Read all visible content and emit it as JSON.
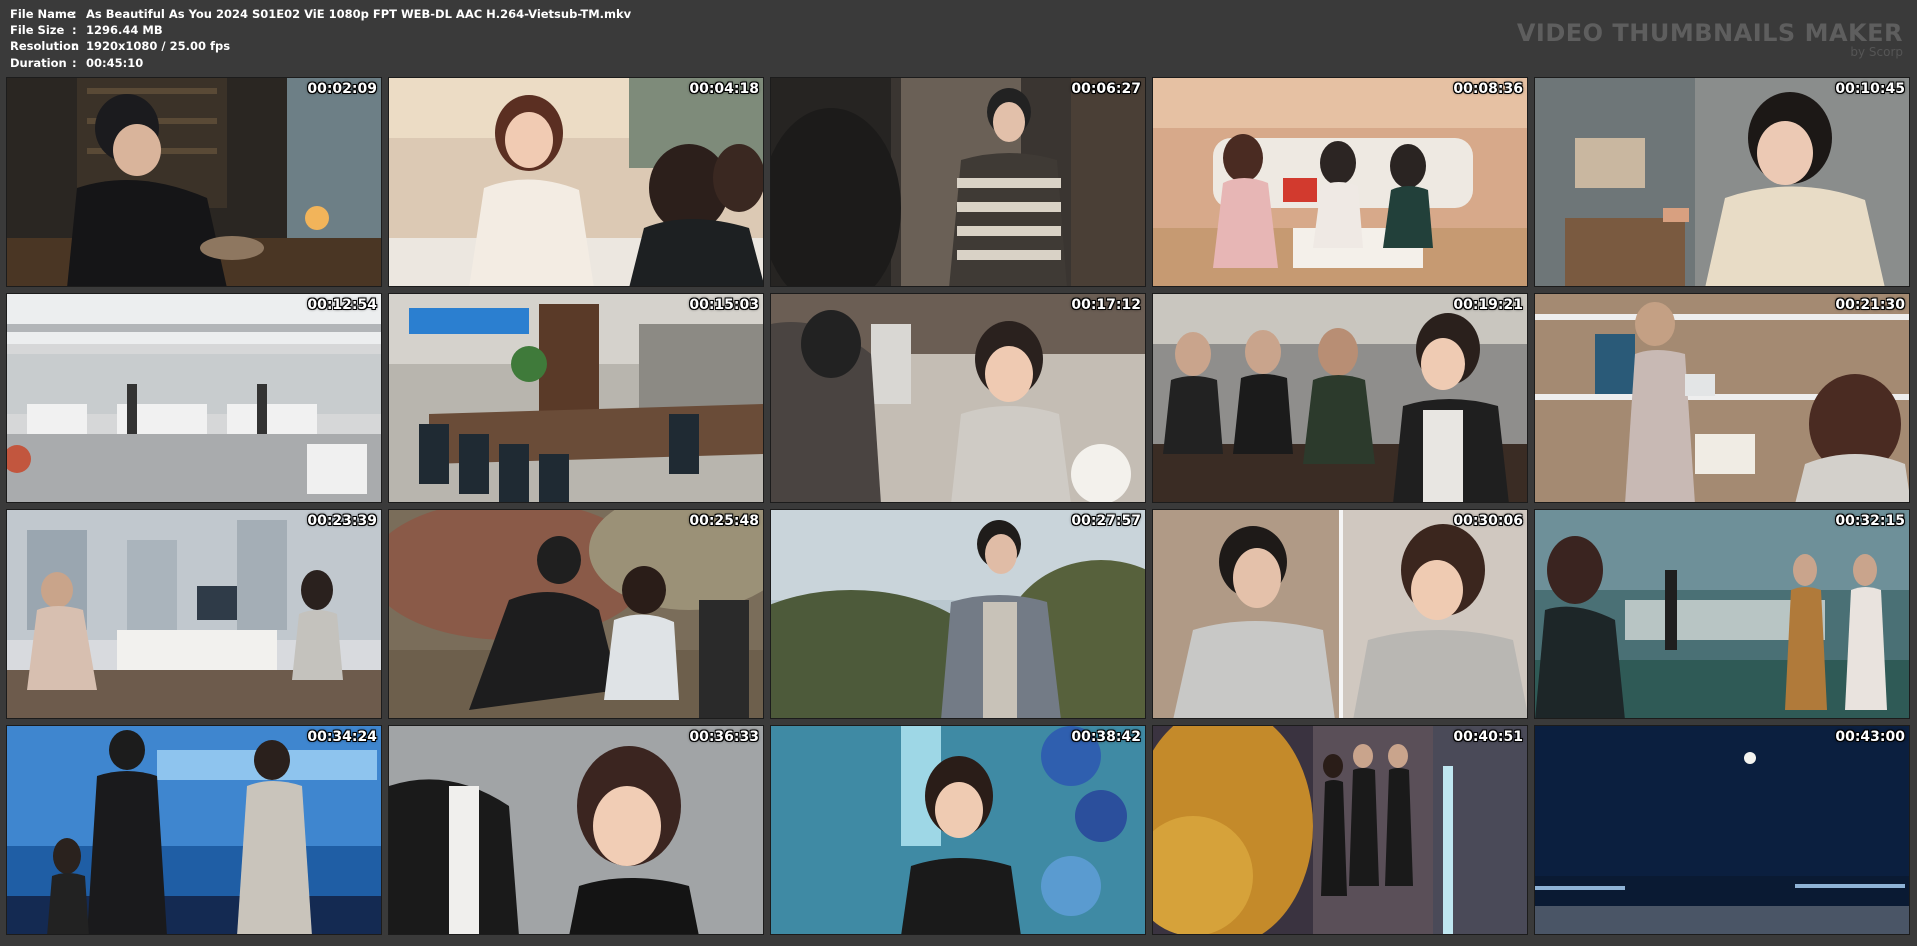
{
  "file_info": {
    "file_name": {
      "key": "File Name",
      "sep": ":",
      "value": "As Beautiful As You 2024 S01E02 ViE 1080p FPT WEB-DL AAC H.264-Vietsub-TM.mkv"
    },
    "file_size": {
      "key": "File Size",
      "sep": ":",
      "value": "1296.44 MB"
    },
    "resolution": {
      "key": "Resolution",
      "sep": ":",
      "value": "1920x1080 / 25.00 fps"
    },
    "duration": {
      "key": "Duration",
      "sep": ":",
      "value": "00:45:10"
    }
  },
  "brand": {
    "title": "VIDEO THUMBNAILS MAKER",
    "subtitle": "by Scorp"
  },
  "thumbnails": [
    {
      "timestamp": "00:02:09"
    },
    {
      "timestamp": "00:04:18"
    },
    {
      "timestamp": "00:06:27"
    },
    {
      "timestamp": "00:08:36"
    },
    {
      "timestamp": "00:10:45"
    },
    {
      "timestamp": "00:12:54"
    },
    {
      "timestamp": "00:15:03"
    },
    {
      "timestamp": "00:17:12"
    },
    {
      "timestamp": "00:19:21"
    },
    {
      "timestamp": "00:21:30"
    },
    {
      "timestamp": "00:23:39"
    },
    {
      "timestamp": "00:25:48"
    },
    {
      "timestamp": "00:27:57"
    },
    {
      "timestamp": "00:30:06"
    },
    {
      "timestamp": "00:32:15"
    },
    {
      "timestamp": "00:34:24"
    },
    {
      "timestamp": "00:36:33"
    },
    {
      "timestamp": "00:38:42"
    },
    {
      "timestamp": "00:40:51"
    },
    {
      "timestamp": "00:43:00"
    }
  ]
}
